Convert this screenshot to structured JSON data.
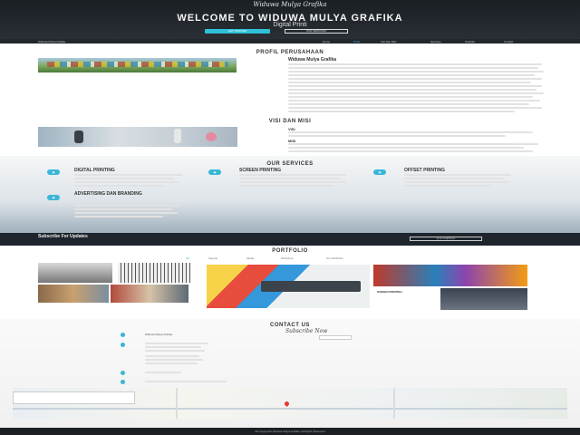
{
  "hero": {
    "brand": "Widuwa Mulya Grafika",
    "headline": "WELCOME TO WIDUWA MULYA GRAFIKA",
    "subheadline": "Digital Printi",
    "primary_button": "GET STARTED",
    "secondary_button": "OUR SERVICES"
  },
  "nav": {
    "logo": "Widuwa Mulya Grafika",
    "items": [
      "Home",
      "Profil",
      "Visi Dan Misi",
      "Services",
      "Portfolio",
      "Contact"
    ]
  },
  "profile": {
    "title": "PROFIL PERUSAHAAN",
    "company_name": "Widuwa Mulya Grafika"
  },
  "vision": {
    "title": "VISI DAN MISI",
    "vision_label": "VISI",
    "mission_label": "MISI"
  },
  "services": {
    "title": "OUR SERVICES",
    "items": [
      {
        "title": "DIGITAL PRINTING",
        "icon": "printer-icon"
      },
      {
        "title": "SCREEN PRINTING",
        "icon": "screen-icon"
      },
      {
        "title": "OFFSET PRINTING",
        "icon": "offset-icon"
      },
      {
        "title": "ADVERTISING DAN BRANDING",
        "icon": "megaphone-icon"
      }
    ]
  },
  "subscribe": {
    "title": "Subscribe For Updates",
    "input_placeholder": "your email here"
  },
  "portfolio": {
    "title": "PORTFOLIO",
    "filters": [
      "All",
      "Sample",
      "Media",
      "Workshop",
      "Our Exhibition"
    ],
    "caption": "SCREEN PRINTING"
  },
  "contact": {
    "title": "CONTACT US",
    "subscribe_title": "Subscribe Now",
    "company": "Widuwa Mulya Grafika"
  },
  "footer": {
    "text": "All Copyrights Widuwa Mulya Grafika, All Rights Reserved"
  },
  "colors": {
    "accent": "#2ec1d8",
    "dark": "#1e252c"
  }
}
